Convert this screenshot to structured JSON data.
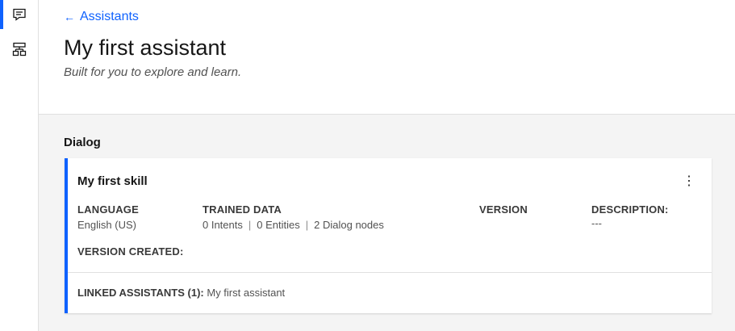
{
  "rail": {
    "items": [
      {
        "name": "assistants",
        "icon": "chat-bubble-icon",
        "active": true
      },
      {
        "name": "skills",
        "icon": "skill-tree-icon",
        "active": false
      }
    ]
  },
  "header": {
    "back_arrow": "←",
    "back_label": "Assistants",
    "title": "My first assistant",
    "subtitle": "Built for you to explore and learn."
  },
  "dialog": {
    "section_title": "Dialog",
    "skill": {
      "name": "My first skill",
      "overflow_icon": "⋮",
      "language": {
        "label": "LANGUAGE",
        "value": "English (US)"
      },
      "trained_data": {
        "label": "TRAINED DATA",
        "intents": "0 Intents",
        "entities": "0 Entities",
        "dialog_nodes": "2 Dialog nodes",
        "separator": "|"
      },
      "version": {
        "label": "VERSION",
        "value": ""
      },
      "description": {
        "label": "DESCRIPTION:",
        "value": "---"
      },
      "version_created": {
        "label": "VERSION CREATED:",
        "value": ""
      },
      "linked": {
        "label": "LINKED ASSISTANTS (1):",
        "value": "My first assistant"
      }
    }
  },
  "colors": {
    "accent": "#0f62fe",
    "text": "#161616",
    "muted": "#525252",
    "background": "#f4f4f4"
  }
}
